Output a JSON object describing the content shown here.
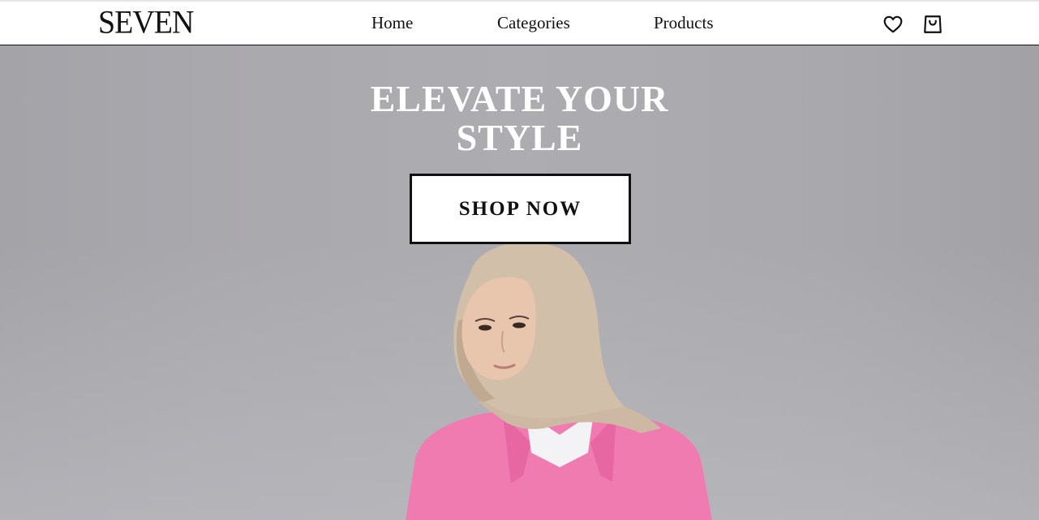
{
  "navbar": {
    "logo": "SEVEN",
    "links": [
      {
        "label": "Home"
      },
      {
        "label": "Categories"
      },
      {
        "label": "Products"
      }
    ],
    "icons": [
      "heart-icon",
      "shopping-bag-icon"
    ]
  },
  "hero": {
    "title_line1": "ELEVATE YOUR",
    "title_line2": "STYLE",
    "cta_label": "SHOP NOW",
    "background_color": "#a9a9ad",
    "accent_color": "#111111"
  }
}
